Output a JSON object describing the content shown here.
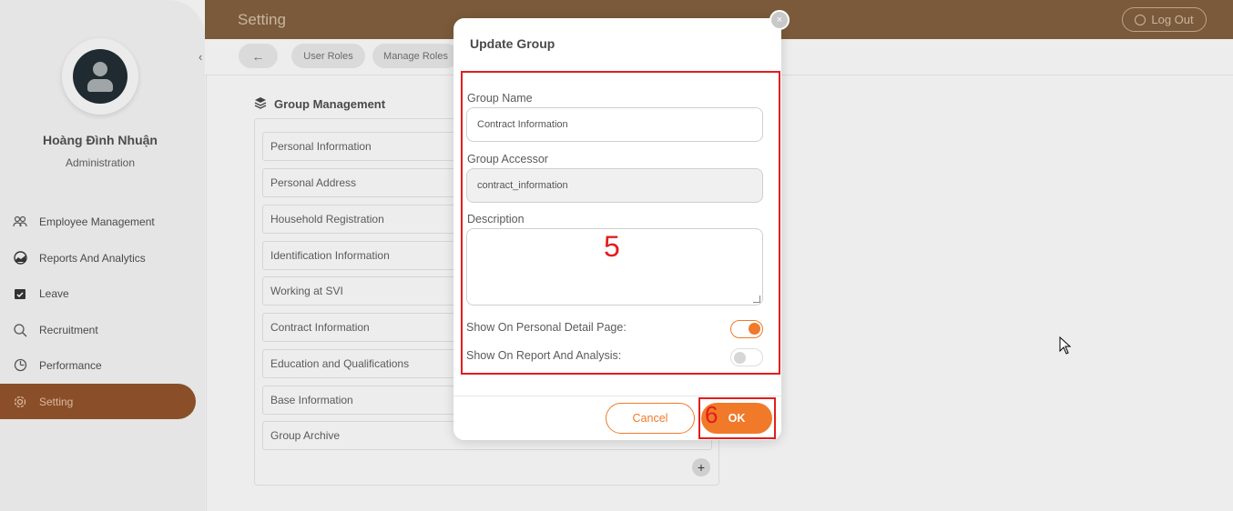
{
  "header": {
    "title": "Setting",
    "logout_label": "Log Out"
  },
  "sidebar": {
    "user_name": "Hoàng Đình Nhuận",
    "user_role": "Administration",
    "items": [
      {
        "label": "Employee Management",
        "icon": "people-icon"
      },
      {
        "label": "Reports And Analytics",
        "icon": "chart-icon"
      },
      {
        "label": "Leave",
        "icon": "calendar-check-icon"
      },
      {
        "label": "Recruitment",
        "icon": "recruit-icon"
      },
      {
        "label": "Performance",
        "icon": "gauge-icon"
      },
      {
        "label": "Setting",
        "icon": "gear-icon",
        "active": true
      }
    ]
  },
  "toolbar": {
    "back_icon": "arrow-left-icon",
    "tabs": [
      "User Roles",
      "Manage Roles"
    ]
  },
  "group_management": {
    "title": "Group Management",
    "rows": [
      "Personal Information",
      "Personal Address",
      "Household Registration",
      "Identification Information",
      "Working at SVI",
      "Contract Information",
      "Education and Qualifications",
      "Base Information",
      "Group Archive"
    ],
    "add_label": "+"
  },
  "modal": {
    "title": "Update Group",
    "close_label": "×",
    "group_name_label": "Group Name",
    "group_name_value": "Contract Information",
    "group_accessor_label": "Group Accessor",
    "group_accessor_value": "contract_information",
    "description_label": "Description",
    "description_value": "",
    "show_personal_label": "Show On Personal Detail Page:",
    "show_personal_on": true,
    "show_report_label": "Show On Report And Analysis:",
    "show_report_on": false,
    "cancel_label": "Cancel",
    "ok_label": "OK"
  },
  "annotations": {
    "step5": "5",
    "step6": "6"
  },
  "colors": {
    "accent": "#f07a2a",
    "highlight": "#e31d1d"
  }
}
